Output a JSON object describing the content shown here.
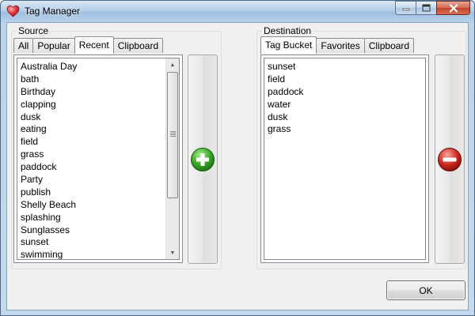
{
  "window": {
    "title": "Tag Manager",
    "icon": "heart-icon",
    "controls": [
      "minimize-icon",
      "maximize-icon",
      "close-icon"
    ]
  },
  "source": {
    "title": "Source",
    "tabs": [
      {
        "label": "All",
        "active": false
      },
      {
        "label": "Popular",
        "active": false
      },
      {
        "label": "Recent",
        "active": true
      },
      {
        "label": "Clipboard",
        "active": false
      }
    ],
    "items": [
      "Australia Day",
      "bath",
      "Birthday",
      "clapping",
      "dusk",
      "eating",
      "field",
      "grass",
      "paddock",
      "Party",
      "publish",
      "Shelly Beach",
      "splashing",
      "Sunglasses",
      "sunset",
      "swimming"
    ]
  },
  "add_button": {
    "icon": "add-icon",
    "color": "#2ea12e"
  },
  "destination": {
    "title": "Destination",
    "tabs": [
      {
        "label": "Tag Bucket",
        "active": true
      },
      {
        "label": "Favorites",
        "active": false
      },
      {
        "label": "Clipboard",
        "active": false
      }
    ],
    "items": [
      "sunset",
      "field",
      "paddock",
      "water",
      "dusk",
      "grass"
    ]
  },
  "remove_button": {
    "icon": "remove-icon",
    "color": "#c8221c"
  },
  "footer": {
    "ok_label": "OK"
  }
}
